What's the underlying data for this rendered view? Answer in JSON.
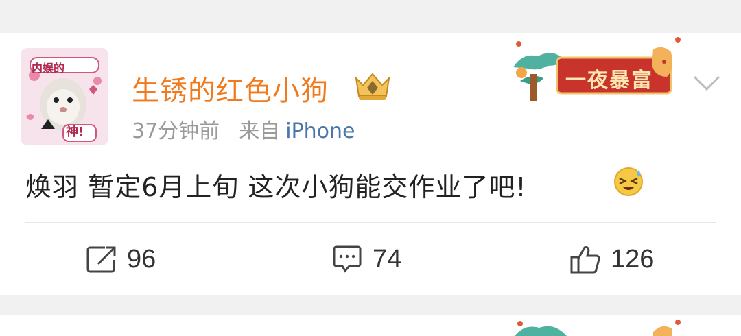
{
  "post": {
    "username": "生锈的红色小狗",
    "time": "37分钟前",
    "from_label": "来自",
    "source": "iPhone",
    "text": "焕羽 暂定6月上旬 这次小狗能交作业了吧!",
    "avatar_caption_top": "内娱的",
    "avatar_caption_bottom": "神!",
    "badge_text": "一夜暴富"
  },
  "actions": {
    "repost_count": "96",
    "comment_count": "74",
    "like_count": "126"
  },
  "icons": {
    "crown": "crown-icon",
    "more": "chevron-down-icon",
    "repost": "share-icon",
    "comment": "comment-icon",
    "like": "thumbs-up-icon",
    "emoji": "laughing-sweat-emoji"
  },
  "colors": {
    "username": "#f07a1e",
    "meta": "#9a9a9a",
    "source": "#4a76a8",
    "badge_red": "#c8332b",
    "badge_text": "#fde7b0"
  }
}
